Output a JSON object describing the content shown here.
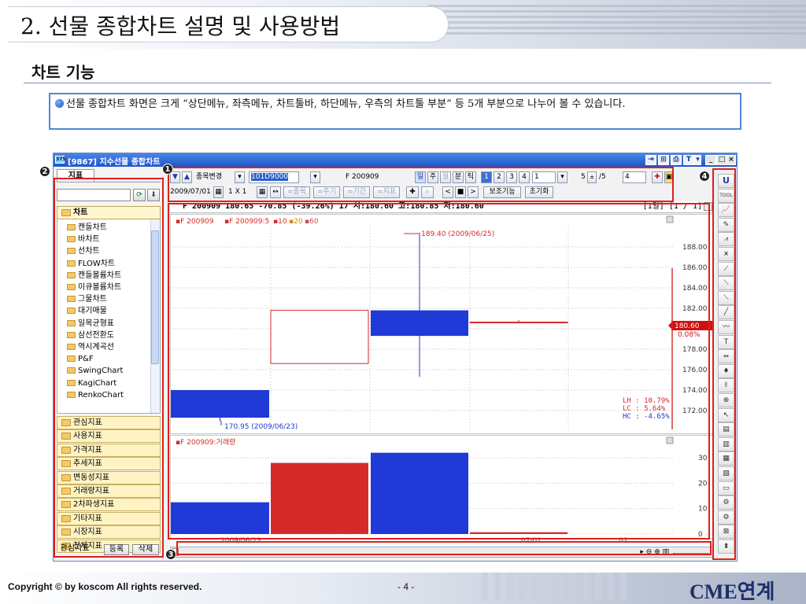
{
  "slide": {
    "title": "2. 선물 종합차트 설명 및 사용방법",
    "subtitle": "차트 기능",
    "description": "선물 종합차트 화면은 크게 “상단메뉴, 좌측메뉴, 차트툴바, 하단메뉴, 우측의 차트툴 부분” 등 5개 부분으로 나누어 볼 수 있습니다."
  },
  "window": {
    "title": "[9867] 지수선물 종합차트",
    "app_icon": "375"
  },
  "left_panel": {
    "tab": "지표",
    "chart_header": "차트",
    "tree_items": [
      "캔들차트",
      "바차트",
      "선차트",
      "FLOW차트",
      "캔들볼륨차트",
      "이큐볼륨차트",
      "그물차트",
      "대기매물",
      "일목균형표",
      "삼선전환도",
      "역시계곡선",
      "P&F",
      "SwingChart",
      "KagiChart",
      "RenkoChart"
    ],
    "categories": [
      "관심지표",
      "사용지표",
      "가격지표",
      "추세지표",
      "변동성지표",
      "거래량지표",
      "2차파생지표",
      "기타지표",
      "시장지표",
      "전체지표"
    ],
    "bottom_label": "관심지표",
    "register_button": "등록",
    "delete_button": "삭제"
  },
  "toolbar1": {
    "change_code": "종목변경",
    "code": "101D9000",
    "name": "F 200909",
    "periods": [
      "일",
      "주",
      "월",
      "분",
      "틱"
    ],
    "numbers": [
      "1",
      "2",
      "3",
      "4"
    ],
    "count": "1",
    "paging": "5",
    "total": "/5",
    "value": "4"
  },
  "toolbar2": {
    "date": "2009/07/01",
    "scale": "1 X 1",
    "buttons": [
      "=종목",
      "=주기",
      "=기간",
      "=지표"
    ],
    "aux_function": "보조기능",
    "reset": "초기화"
  },
  "info_bar": {
    "text": "F 200909   180.65  -70.85 (-39.26%)   17  시:180.60 고:180.85 저:180.60",
    "right": "[1일] [1 / 1]"
  },
  "price_chart": {
    "legend_name": "F 200909",
    "legend_ma": "F 200909:5",
    "legend_periods": [
      "10",
      "20",
      "60"
    ],
    "high_label": "189.40 (2009/06/25)",
    "low_label": "170.95 (2009/06/23)",
    "current_price": "180.60",
    "current_pct": "0.08%",
    "lh": "LH : 10.79%",
    "lc": "LC :  5.64%",
    "hc": "HC : -4.65%",
    "y_ticks": [
      "188.00",
      "186.00",
      "184.00",
      "182.00",
      "178.00",
      "176.00",
      "174.00",
      "172.00"
    ]
  },
  "volume_chart": {
    "legend": "F 200909:거래량",
    "y_ticks": [
      "30",
      "20",
      "10",
      "0"
    ]
  },
  "x_axis": [
    "2009/06/23",
    "07/01",
    "02"
  ],
  "right_toolbar": {
    "top_label": "U",
    "tool_label": "TOOL"
  },
  "annotations": [
    "1",
    "2",
    "3",
    "4"
  ],
  "footer": {
    "copyright": "Copyright © by koscom All rights reserved.",
    "page": "- 4 -",
    "brand": "CME연계"
  },
  "colors": {
    "annotation": "#e01e1e",
    "up_candle": "#d62a2a",
    "down_candle": "#1f3ad6",
    "titlebar": "#1d56c9",
    "desc_border": "#4f86d9"
  },
  "chart_data": [
    {
      "type": "candlestick",
      "ylim": [
        170,
        190
      ],
      "candles": [
        {
          "x": "2009/06/23",
          "open": 174.0,
          "high": 174.0,
          "low": 170.95,
          "close": 171.3
        },
        {
          "x": "2009/06/24",
          "open": 176.6,
          "high": 181.8,
          "low": 176.6,
          "close": 181.8
        },
        {
          "x": "2009/06/25",
          "open": 181.8,
          "high": 189.4,
          "low": 175.3,
          "close": 179.3
        },
        {
          "x": "2009/07/01",
          "open": 180.6,
          "high": 180.85,
          "low": 180.6,
          "close": 180.65
        }
      ]
    },
    {
      "type": "bar",
      "ylim": [
        0,
        35
      ],
      "values": [
        12.5,
        28,
        32,
        0.7
      ],
      "colors": [
        "#1f3ad6",
        "#d62a2a",
        "#1f3ad6",
        "#d62a2a"
      ]
    }
  ]
}
